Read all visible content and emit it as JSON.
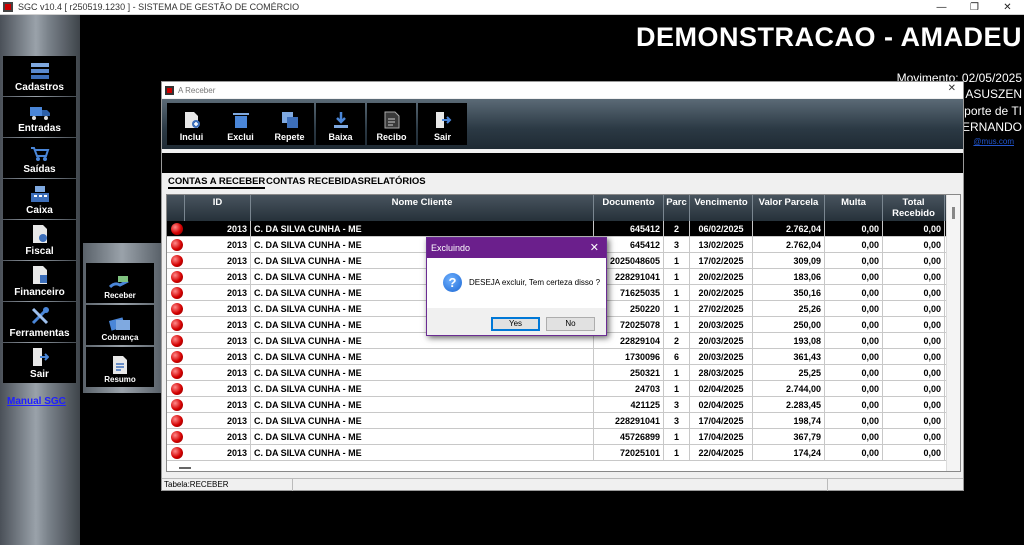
{
  "app": {
    "title": "SGC v10.4 [ r250519.1230 ] - SISTEMA DE GESTÃO DE COMÉRCIO",
    "controls": {
      "minimize": "—",
      "maximize": "❐",
      "close": "✕"
    }
  },
  "sidebar": {
    "items": [
      {
        "label": "Cadastros",
        "icon": "database-icon"
      },
      {
        "label": "Entradas",
        "icon": "truck-icon"
      },
      {
        "label": "Saídas",
        "icon": "cart-icon"
      },
      {
        "label": "Caixa",
        "icon": "cash-register-icon"
      },
      {
        "label": "Fiscal",
        "icon": "fiscal-document-icon"
      },
      {
        "label": "Financeiro",
        "icon": "finance-document-icon"
      },
      {
        "label": "Ferramentas",
        "icon": "tools-icon"
      },
      {
        "label": "Sair",
        "icon": "exit-door-icon"
      }
    ],
    "manual_link": "Manual SGC"
  },
  "submenu": {
    "items": [
      {
        "label": "Receber",
        "icon": "hand-money-icon"
      },
      {
        "label": "Cobrança",
        "icon": "cards-icon"
      },
      {
        "label": "Resumo",
        "icon": "summary-doc-icon"
      }
    ]
  },
  "background": {
    "company": "DEMONSTRACAO - AMADEU",
    "movimento": "Movimento: 02/05/2025",
    "line2": "ASUSZEN",
    "line3": "porte de TI",
    "line4": "ERNANDO",
    "email": "@mus.com"
  },
  "window": {
    "title": "A Receber",
    "close": "✕",
    "toolbar": [
      {
        "label": "Inclui",
        "icon": "add-doc-icon"
      },
      {
        "label": "Exclui",
        "icon": "trash-icon"
      },
      {
        "label": "Repete",
        "icon": "copy-icon"
      },
      {
        "label": "Baixa",
        "icon": "download-icon"
      },
      {
        "label": "Recibo",
        "icon": "receipt-icon"
      },
      {
        "label": "Sair",
        "icon": "exit-icon"
      }
    ],
    "tabs": [
      "CONTAS A RECEBER",
      "CONTAS RECEBIDAS",
      "RELATÓRIOS"
    ],
    "status": {
      "table": "Tabela:RECEBER"
    }
  },
  "table": {
    "headers": [
      "ID",
      "Nome Cliente",
      "Documento",
      "Parc",
      "Vencimento",
      "Valor Parcela",
      "Multa",
      "Total Recebido"
    ],
    "rows": [
      {
        "id": "2013",
        "cliente": "C. DA SILVA CUNHA - ME",
        "documento": "645412",
        "parc": "2",
        "vencimento": "06/02/2025",
        "valor": "2.762,04",
        "multa": "0,00",
        "total": "0,00"
      },
      {
        "id": "2013",
        "cliente": "C. DA SILVA CUNHA - ME",
        "documento": "645412",
        "parc": "3",
        "vencimento": "13/02/2025",
        "valor": "2.762,04",
        "multa": "0,00",
        "total": "0,00"
      },
      {
        "id": "2013",
        "cliente": "C. DA SILVA CUNHA - ME",
        "documento": "2025048605",
        "parc": "1",
        "vencimento": "17/02/2025",
        "valor": "309,09",
        "multa": "0,00",
        "total": "0,00"
      },
      {
        "id": "2013",
        "cliente": "C. DA SILVA CUNHA - ME",
        "documento": "228291041",
        "parc": "1",
        "vencimento": "20/02/2025",
        "valor": "183,06",
        "multa": "0,00",
        "total": "0,00"
      },
      {
        "id": "2013",
        "cliente": "C. DA SILVA CUNHA - ME",
        "documento": "71625035",
        "parc": "1",
        "vencimento": "20/02/2025",
        "valor": "350,16",
        "multa": "0,00",
        "total": "0,00"
      },
      {
        "id": "2013",
        "cliente": "C. DA SILVA CUNHA - ME",
        "documento": "250220",
        "parc": "1",
        "vencimento": "27/02/2025",
        "valor": "25,26",
        "multa": "0,00",
        "total": "0,00"
      },
      {
        "id": "2013",
        "cliente": "C. DA SILVA CUNHA - ME",
        "documento": "72025078",
        "parc": "1",
        "vencimento": "20/03/2025",
        "valor": "250,00",
        "multa": "0,00",
        "total": "0,00"
      },
      {
        "id": "2013",
        "cliente": "C. DA SILVA CUNHA - ME",
        "documento": "22829104",
        "parc": "2",
        "vencimento": "20/03/2025",
        "valor": "193,08",
        "multa": "0,00",
        "total": "0,00"
      },
      {
        "id": "2013",
        "cliente": "C. DA SILVA CUNHA - ME",
        "documento": "1730096",
        "parc": "6",
        "vencimento": "20/03/2025",
        "valor": "361,43",
        "multa": "0,00",
        "total": "0,00"
      },
      {
        "id": "2013",
        "cliente": "C. DA SILVA CUNHA - ME",
        "documento": "250321",
        "parc": "1",
        "vencimento": "28/03/2025",
        "valor": "25,25",
        "multa": "0,00",
        "total": "0,00"
      },
      {
        "id": "2013",
        "cliente": "C. DA SILVA CUNHA - ME",
        "documento": "24703",
        "parc": "1",
        "vencimento": "02/04/2025",
        "valor": "2.744,00",
        "multa": "0,00",
        "total": "0,00"
      },
      {
        "id": "2013",
        "cliente": "C. DA SILVA CUNHA - ME",
        "documento": "421125",
        "parc": "3",
        "vencimento": "02/04/2025",
        "valor": "2.283,45",
        "multa": "0,00",
        "total": "0,00"
      },
      {
        "id": "2013",
        "cliente": "C. DA SILVA CUNHA - ME",
        "documento": "228291041",
        "parc": "3",
        "vencimento": "17/04/2025",
        "valor": "198,74",
        "multa": "0,00",
        "total": "0,00"
      },
      {
        "id": "2013",
        "cliente": "C. DA SILVA CUNHA - ME",
        "documento": "45726899",
        "parc": "1",
        "vencimento": "17/04/2025",
        "valor": "367,79",
        "multa": "0,00",
        "total": "0,00"
      },
      {
        "id": "2013",
        "cliente": "C. DA SILVA CUNHA - ME",
        "documento": "72025101",
        "parc": "1",
        "vencimento": "22/04/2025",
        "valor": "174,24",
        "multa": "0,00",
        "total": "0,00"
      }
    ]
  },
  "dialog": {
    "title": "Excluindo",
    "close": "✕",
    "icon": "question-icon",
    "icon_glyph": "?",
    "message": "DESEJA excluir, Tem certeza disso ?",
    "yes": "Yes",
    "no": "No"
  }
}
